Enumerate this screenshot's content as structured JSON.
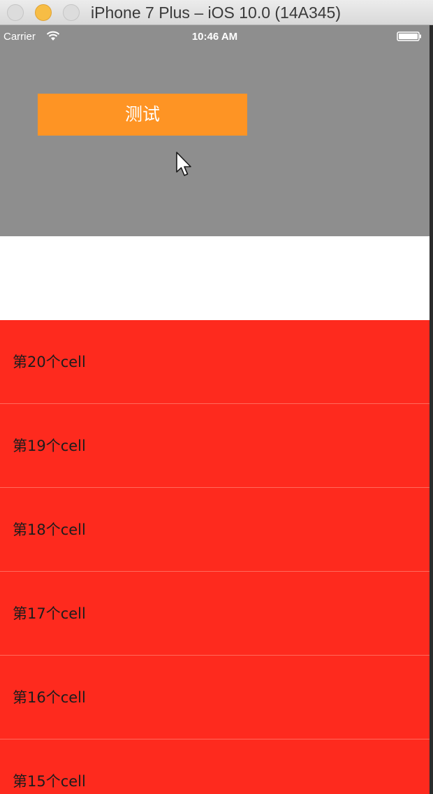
{
  "window": {
    "title": "iPhone 7 Plus – iOS 10.0 (14A345)"
  },
  "status_bar": {
    "carrier": "Carrier",
    "time": "10:46 AM",
    "wifi_icon": "wifi-icon",
    "battery_icon": "battery-icon"
  },
  "header": {
    "background_color": "#8e8e8e",
    "button_label": "测试",
    "button_color": "#fe9424"
  },
  "table": {
    "cell_color": "#fe2a1e",
    "cells": [
      {
        "label": "第20个cell"
      },
      {
        "label": "第19个cell"
      },
      {
        "label": "第18个cell"
      },
      {
        "label": "第17个cell"
      },
      {
        "label": "第16个cell"
      },
      {
        "label": "第15个cell"
      }
    ]
  }
}
